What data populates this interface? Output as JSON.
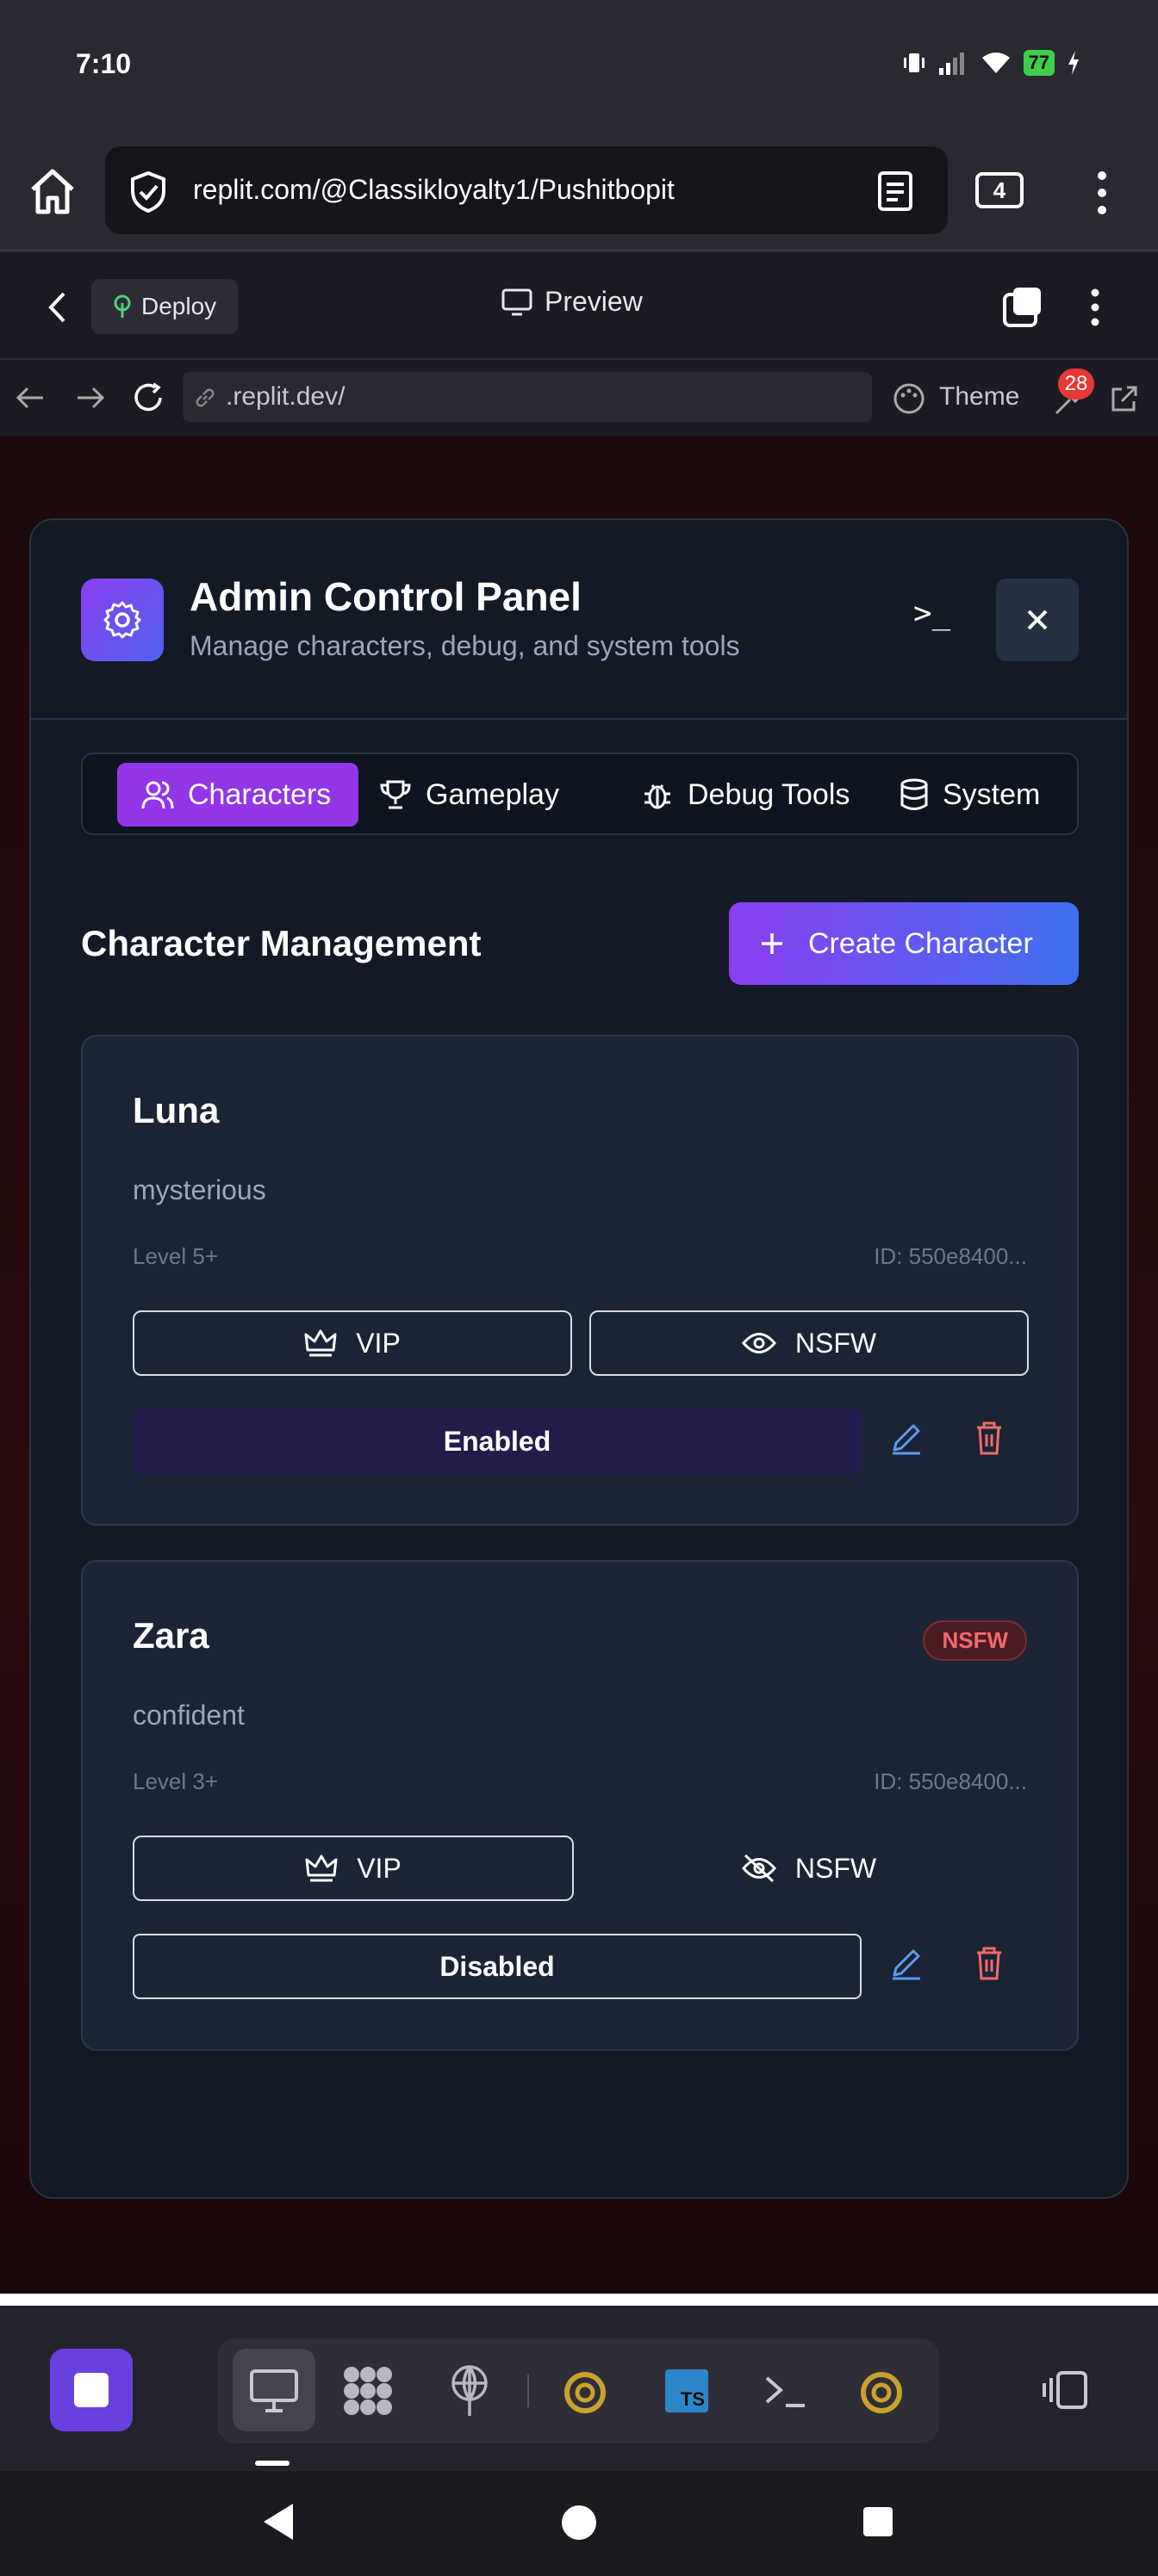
{
  "status_bar": {
    "time": "7:10",
    "battery": "77"
  },
  "browser": {
    "url": "replit.com/@Classikloyalty1/Pushitbopit",
    "tab_count": "4"
  },
  "replit": {
    "deploy_label": "Deploy",
    "preview_label": "Preview",
    "address": ".replit.dev/",
    "theme_label": "Theme",
    "tool_badge": "28"
  },
  "modal": {
    "title": "Admin Control Panel",
    "subtitle": "Manage characters, debug, and system tools",
    "terminal_glyph": ">_",
    "tabs": [
      {
        "label": "Characters",
        "icon": "users-icon",
        "active": true
      },
      {
        "label": "Gameplay",
        "icon": "trophy-icon",
        "active": false
      },
      {
        "label": "Debug Tools",
        "icon": "bug-icon",
        "active": false
      },
      {
        "label": "System",
        "icon": "database-icon",
        "active": false
      }
    ],
    "section_title": "Character Management",
    "create_label": "Create Character",
    "characters": [
      {
        "name": "Luna",
        "personality": "mysterious",
        "level": "Level 5+",
        "id": "ID: 550e8400...",
        "vip_label": "VIP",
        "nsfw_label": "NSFW",
        "status": "Enabled"
      },
      {
        "name": "Zara",
        "tag": "NSFW",
        "personality": "confident",
        "level": "Level 3+",
        "id": "ID: 550e8400...",
        "vip_label": "VIP",
        "nsfw_label": "NSFW",
        "status": "Disabled"
      }
    ]
  },
  "colors": {
    "accent_purple": "#9336e8",
    "accent_blue": "#3f6ff0",
    "danger": "#f06a6a",
    "edit": "#5b9bf0"
  }
}
